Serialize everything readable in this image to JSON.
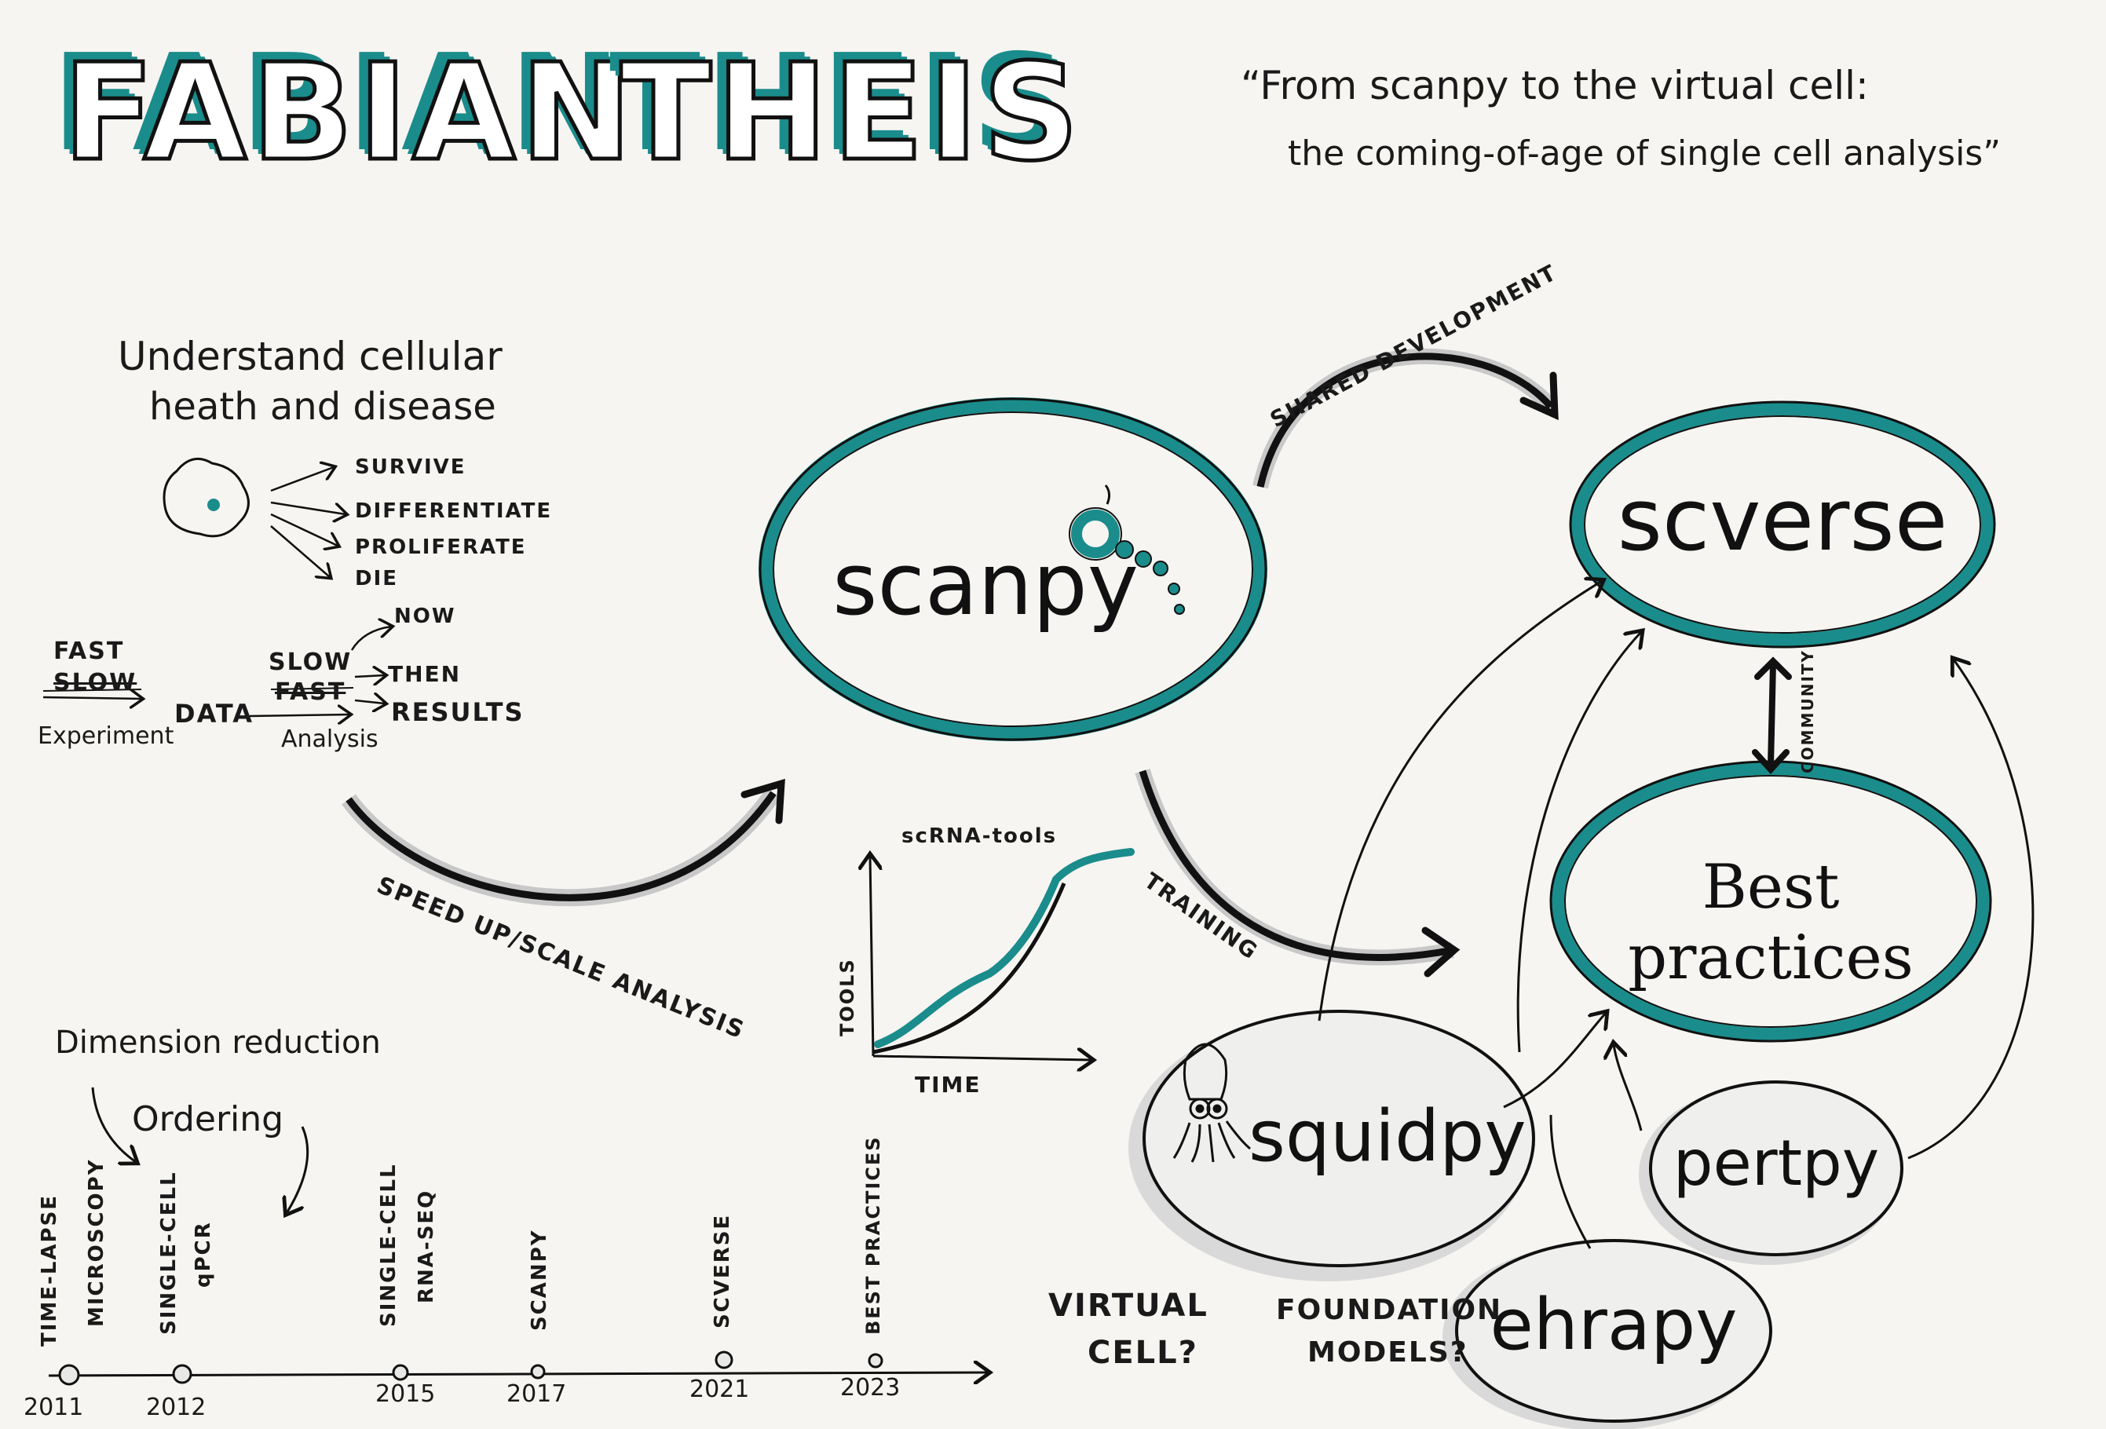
{
  "header": {
    "name_first": "FABIAN",
    "name_last": "THEIS",
    "talk_title_line1": "“From scanpy to the virtual cell:",
    "talk_title_line2": "the coming-of-age of single cell analysis”"
  },
  "intro": {
    "heading_line1": "Understand cellular",
    "heading_line2": "heath and disease",
    "fates": [
      "SURVIVE",
      "DIFFERENTIATE",
      "PROLIFERATE",
      "DIE"
    ]
  },
  "workflow": {
    "experiment_now": "FAST",
    "experiment_then": "SLOW",
    "experiment_label": "Experiment",
    "data_label": "DATA",
    "analysis_now": "SLOW",
    "analysis_then": "FAST",
    "analysis_label": "Analysis",
    "now_label": "NOW",
    "then_label": "THEN",
    "results_label": "RESULTS"
  },
  "arrows": {
    "speed_up": "SPEED UP/SCALE ANALYSIS",
    "shared_dev": "SHARED DEVELOPMENT",
    "training": "TRAINING",
    "community": "COMMUNITY"
  },
  "bubbles": {
    "scanpy": "scanpy",
    "scverse": "scverse",
    "best_practices": "Best practices",
    "squidpy": "squidpy",
    "pertpy": "pertpy",
    "ehrapy": "ehrapy"
  },
  "mini_chart": {
    "title": "scRNA-tools",
    "ylabel": "TOOLS",
    "xlabel": "TIME"
  },
  "history": {
    "dimension_reduction": "Dimension reduction",
    "ordering": "Ordering",
    "events": [
      {
        "year": "2011",
        "label_line1": "TIME-LAPSE",
        "label_line2": "MICROSCOPY"
      },
      {
        "year": "2012",
        "label_line1": "SINGLE-CELL",
        "label_line2": "qPCR"
      },
      {
        "year": "2015",
        "label_line1": "SINGLE-CELL",
        "label_line2": "RNA-SEQ"
      },
      {
        "year": "2017",
        "label_line1": "SCANPY",
        "label_line2": ""
      },
      {
        "year": "2021",
        "label_line1": "SCVERSE",
        "label_line2": ""
      },
      {
        "year": "2023",
        "label_line1": "BEST PRACTICES",
        "label_line2": ""
      }
    ]
  },
  "questions": {
    "virtual_cell_1": "VIRTUAL",
    "virtual_cell_2": "CELL?",
    "foundation_1": "FOUNDATION",
    "foundation_2": "MODELS?"
  },
  "colors": {
    "teal": "#1b8c8c",
    "ink": "#111111",
    "paper": "#f6f5f1",
    "shadow_grey": "#bfbfbf"
  }
}
